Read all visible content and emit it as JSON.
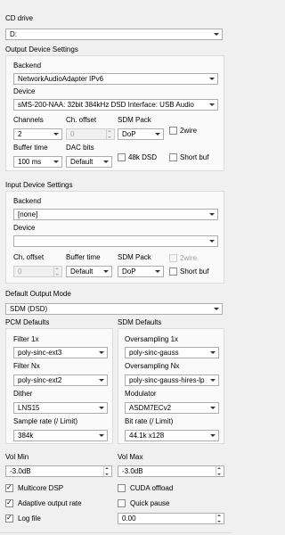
{
  "cd_drive": {
    "label": "CD drive",
    "value": "D:"
  },
  "output_device": {
    "section_title": "Output Device Settings",
    "backend_label": "Backend",
    "backend_value": "NetworkAudioAdapter IPv6",
    "device_label": "Device",
    "device_value": "sMS-200-NAA: 32bit 384kHz DSD Interface: USB Audio",
    "channels_label": "Channels",
    "channels_value": "2",
    "ch_offset_label": "Ch. offset",
    "ch_offset_value": "0",
    "sdm_pack_label": "SDM Pack",
    "sdm_pack_value": "DoP",
    "twowire_label": "2wire",
    "buffer_time_label": "Buffer time",
    "buffer_time_value": "100 ms",
    "dac_bits_label": "DAC bits",
    "dac_bits_value": "Default",
    "dsd48k_label": "48k DSD",
    "short_buf_label": "Short buf"
  },
  "input_device": {
    "section_title": "Input Device Settings",
    "backend_label": "Backend",
    "backend_value": "[none]",
    "device_label": "Device",
    "device_value": "",
    "ch_offset_label": "Ch. offset",
    "ch_offset_value": "0",
    "buffer_time_label": "Buffer time",
    "buffer_time_value": "Default",
    "sdm_pack_label": "SDM Pack",
    "sdm_pack_value": "DoP",
    "twowire_label": "2wire",
    "short_buf_label": "Short buf"
  },
  "default_output_mode": {
    "label": "Default Output Mode",
    "value": "SDM (DSD)"
  },
  "pcm_defaults": {
    "title": "PCM Defaults",
    "filter1x_label": "Filter 1x",
    "filter1x_value": "poly-sinc-ext3",
    "filternx_label": "Filter Nx",
    "filternx_value": "poly-sinc-ext2",
    "dither_label": "Dither",
    "dither_value": "LNS15",
    "rate_label": "Sample rate (/ Limit)",
    "rate_value": "384k"
  },
  "sdm_defaults": {
    "title": "SDM Defaults",
    "os1x_label": "Oversampling 1x",
    "os1x_value": "poly-sinc-gauss",
    "osnx_label": "Oversampling Nx",
    "osnx_value": "poly-sinc-gauss-hires-lp",
    "modulator_label": "Modulator",
    "modulator_value": "ASDM7ECv2",
    "rate_label": "Bit rate (/ Limit)",
    "rate_value": "44.1k x128"
  },
  "vol_min": {
    "label": "Vol Min",
    "value": "-3.0dB"
  },
  "vol_max": {
    "label": "Vol Max",
    "value": "-3.0dB"
  },
  "options": {
    "multicore_label": "Multicore DSP",
    "multicore_checked": true,
    "cuda_label": "CUDA offload",
    "cuda_checked": false,
    "adaptive_label": "Adaptive output rate",
    "adaptive_checked": true,
    "quick_pause_label": "Quick pause",
    "quick_pause_checked": false,
    "log_file_label": "Log file",
    "log_file_checked": true,
    "log_value": "0.00"
  }
}
